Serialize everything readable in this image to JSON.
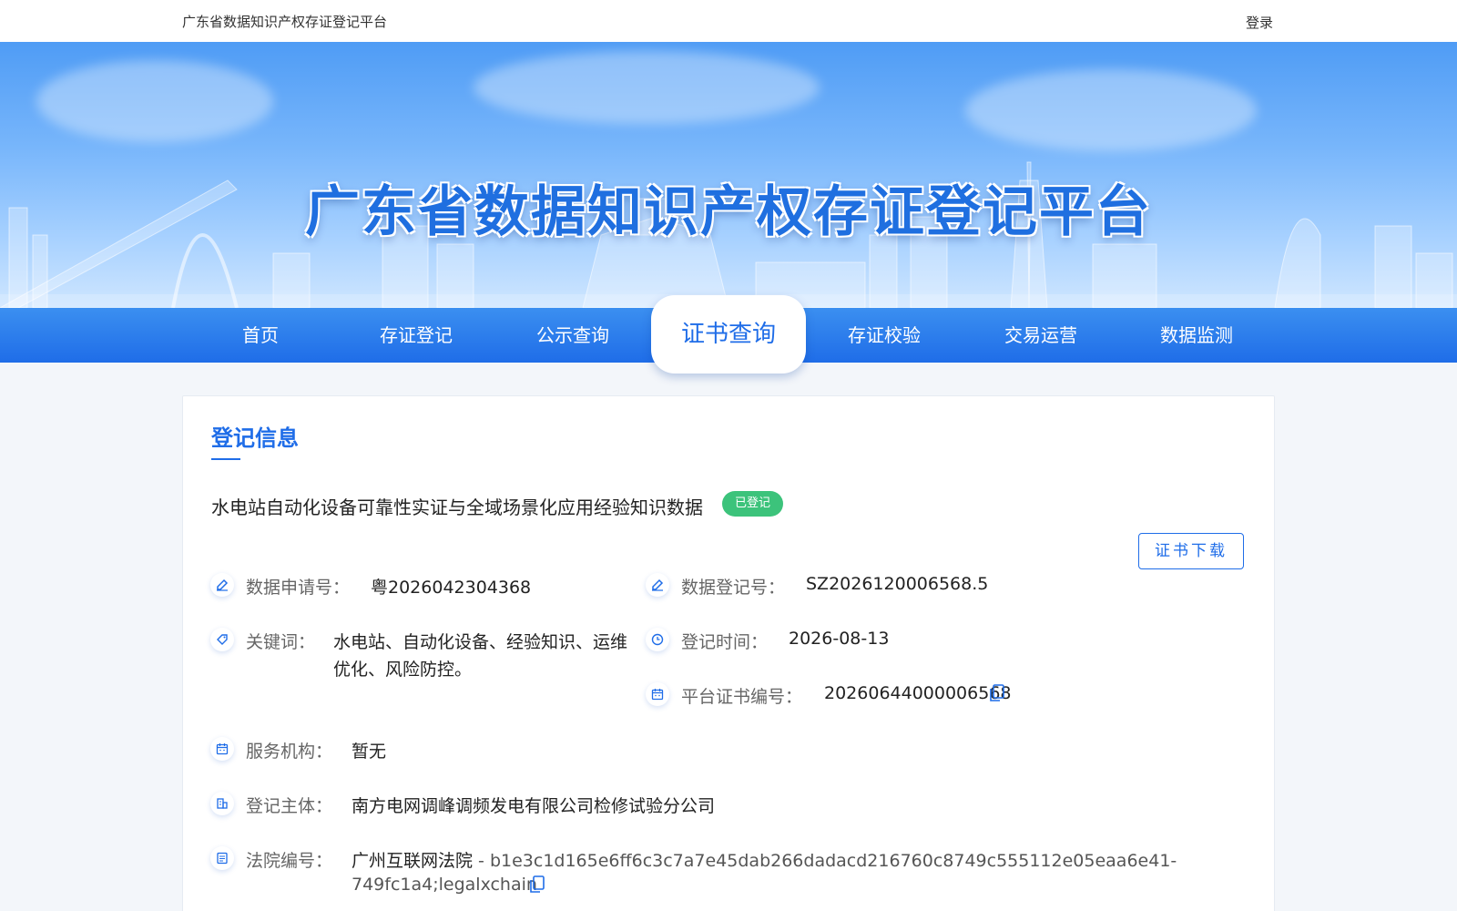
{
  "topbar": {
    "site_name": "广东省数据知识产权存证登记平台",
    "login": "登录"
  },
  "banner": {
    "title": "广东省数据知识产权存证登记平台"
  },
  "nav": {
    "items": [
      "首页",
      "存证登记",
      "公示查询",
      "证书查询",
      "存证校验",
      "交易运营",
      "数据监测"
    ],
    "active_index": 3
  },
  "colors": {
    "primary": "#1f6de8",
    "badge": "#3cc37b"
  },
  "card": {
    "title": "登记信息",
    "data_title": "水电站自动化设备可靠性实证与全域场景化应用经验知识数据",
    "status_badge": "已登记",
    "download_button": "证书下载",
    "fields": {
      "application_no": {
        "label": "数据申请号：",
        "value": "粤2026042304368",
        "icon": "edit-icon"
      },
      "registration_no": {
        "label": "数据登记号：",
        "value": "SZ2026120006568.5",
        "icon": "edit-icon"
      },
      "keywords": {
        "label": "关键词：",
        "value_line1": "水电站、自动化设备、经验知识、运维",
        "value_line2": "优化、风险防控。",
        "icon": "tag-icon"
      },
      "register_time": {
        "label": "登记时间：",
        "value": "2026-08-13",
        "icon": "clock-icon"
      },
      "cert_no": {
        "label": "平台证书编号：",
        "value": "20260644000006568",
        "icon": "calendar-icon"
      },
      "service_org": {
        "label": "服务机构：",
        "value": "暂无",
        "icon": "calendar-icon"
      },
      "subject": {
        "label": "登记主体：",
        "value": "南方电网调峰调频发电有限公司检修试验分公司",
        "icon": "building-icon"
      },
      "court_no": {
        "label": "法院编号：",
        "court": "广州互联网法院",
        "value_line1": " - b1e3c1d165e6ff6c3c7a7e45dab266dadacd216760c8749c555112e05eaa6e41-",
        "value_line2": "749fc1a4;legalxchain",
        "icon": "document-icon"
      }
    }
  }
}
